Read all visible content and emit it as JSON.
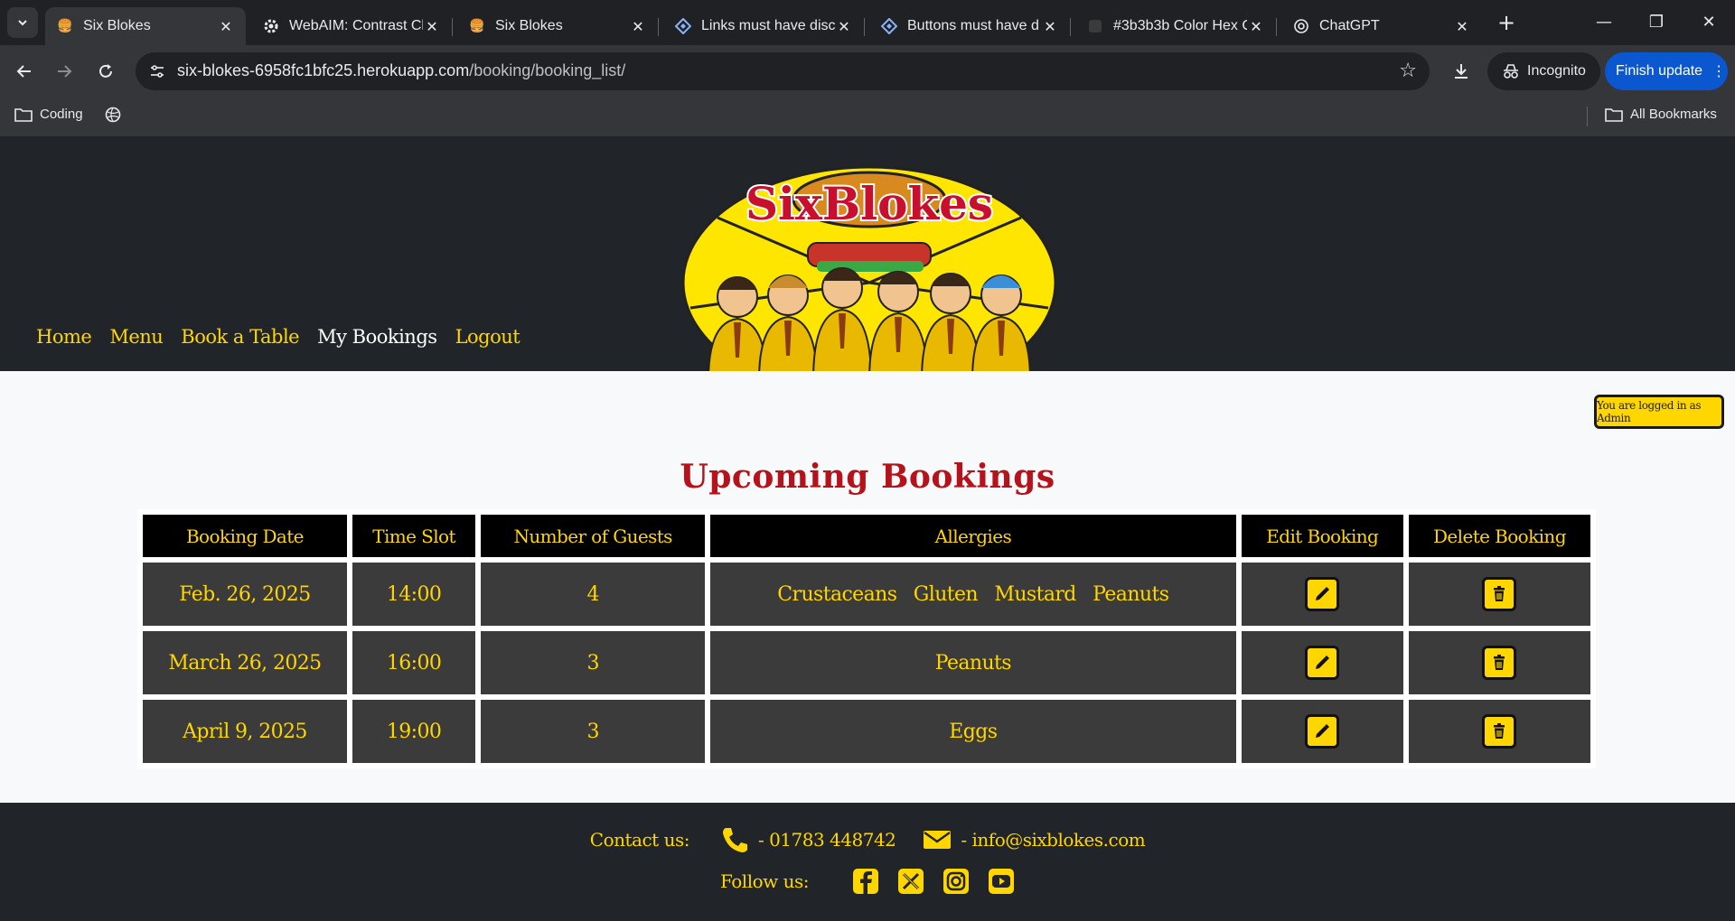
{
  "browser": {
    "tabs": [
      {
        "title": "Six Blokes",
        "icon": "burger-icon",
        "active": true
      },
      {
        "title": "WebAIM: Contrast Ch",
        "icon": "gear-icon",
        "active": false
      },
      {
        "title": "Six Blokes",
        "icon": "burger-icon",
        "active": false
      },
      {
        "title": "Links must have disc",
        "icon": "axe-icon",
        "active": false
      },
      {
        "title": "Buttons must have d",
        "icon": "axe-icon",
        "active": false
      },
      {
        "title": "#3b3b3b Color Hex C",
        "icon": "colorhex-icon",
        "active": false
      },
      {
        "title": "ChatGPT",
        "icon": "chatgpt-icon",
        "active": false
      }
    ],
    "url_domain": "six-blokes-6958fc1bfc25.herokuapp.com",
    "url_path": "/booking/booking_list/",
    "incognito_label": "Incognito",
    "finish_update_label": "Finish update",
    "bookmarks": {
      "coding": "Coding",
      "all": "All Bookmarks"
    }
  },
  "site": {
    "nav": [
      "Home",
      "Menu",
      "Book a Table",
      "My Bookings",
      "Logout"
    ],
    "active_nav": "My Bookings",
    "logo_text": "SixBlokes",
    "admin_badge": "You are logged in as Admin",
    "page_title": "Upcoming Bookings",
    "table": {
      "headers": [
        "Booking Date",
        "Time Slot",
        "Number of Guests",
        "Allergies",
        "Edit Booking",
        "Delete Booking"
      ],
      "rows": [
        {
          "date": "Feb. 26, 2025",
          "time": "14:00",
          "guests": "4",
          "allergies": [
            "Crustaceans",
            "Gluten",
            "Mustard",
            "Peanuts"
          ]
        },
        {
          "date": "March 26, 2025",
          "time": "16:00",
          "guests": "3",
          "allergies": [
            "Peanuts"
          ]
        },
        {
          "date": "April 9, 2025",
          "time": "19:00",
          "guests": "3",
          "allergies": [
            "Eggs"
          ]
        }
      ]
    },
    "footer": {
      "contact_label": "Contact us:",
      "phone": "- 01783 448742",
      "email": "- info@sixblokes.com",
      "follow_label": "Follow us:",
      "social": [
        "facebook-icon",
        "x-twitter-icon",
        "instagram-icon",
        "youtube-icon"
      ]
    }
  },
  "colors": {
    "accent": "#ffd600",
    "title": "#b5121b",
    "cell": "#3b3b3b",
    "header_bg": "#212529"
  }
}
